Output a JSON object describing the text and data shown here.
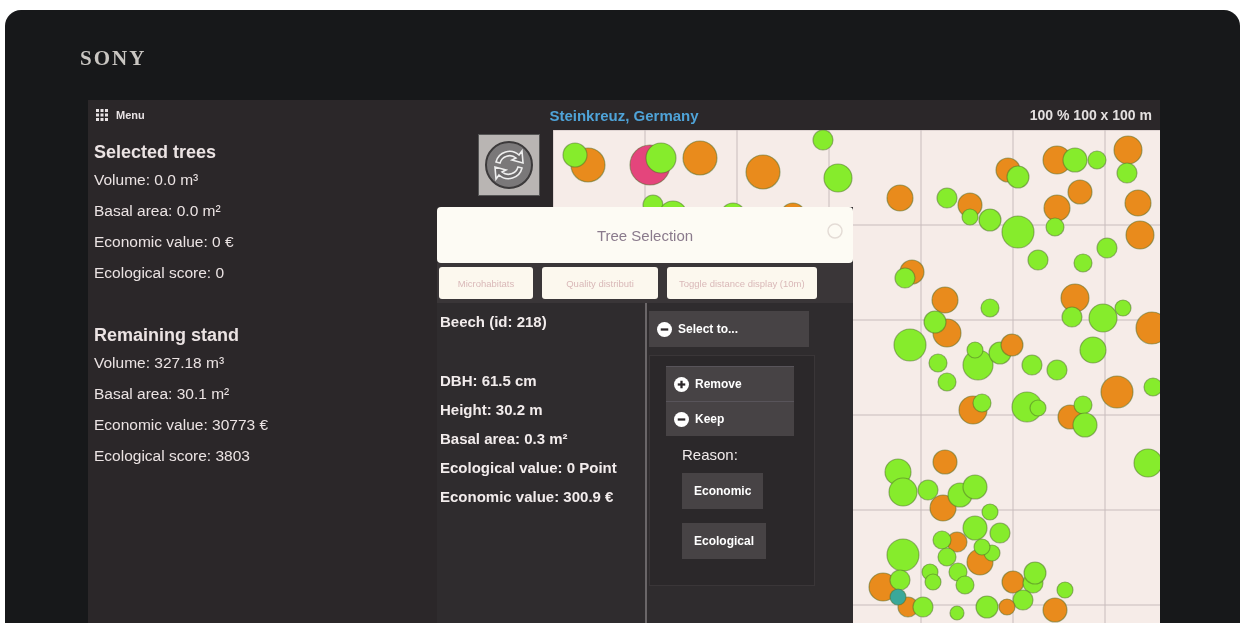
{
  "device": {
    "brand": "SONY"
  },
  "top_bar": {
    "menu_label": "Menu",
    "title": "Steinkreuz, Germany",
    "scale": "100 % 100 x 100 m"
  },
  "selected_trees": {
    "heading": "Selected trees",
    "stats": [
      "Volume: 0.0 m³",
      "Basal area: 0.0 m²",
      "Economic value: 0 €",
      "Ecological score: 0"
    ]
  },
  "remaining_stand": {
    "heading": "Remaining stand",
    "stats": [
      "Volume: 327.18 m³",
      "Basal area: 30.1 m²",
      "Economic value: 30773 €",
      "Ecological score: 3803"
    ]
  },
  "tree_selection_dialog": {
    "title": "Tree Selection",
    "tabs": [
      "Microhabitats",
      "Quality distributi",
      "Toggle distance display (10m)"
    ],
    "tree_name": "Beech (id: 218)",
    "details": [
      "DBH: 61.5 cm",
      "Height: 30.2 m",
      "Basal area: 0.3 m²",
      "Ecological value: 0 Point",
      "Economic value: 300.9 €"
    ],
    "select_panel": {
      "label": "Select to...",
      "expanded": true,
      "options": [
        {
          "label": "Remove",
          "expanded": false
        },
        {
          "label": "Keep",
          "expanded": true,
          "reason_label": "Reason:",
          "reasons": [
            "Economic",
            "Ecological"
          ]
        }
      ]
    }
  }
}
